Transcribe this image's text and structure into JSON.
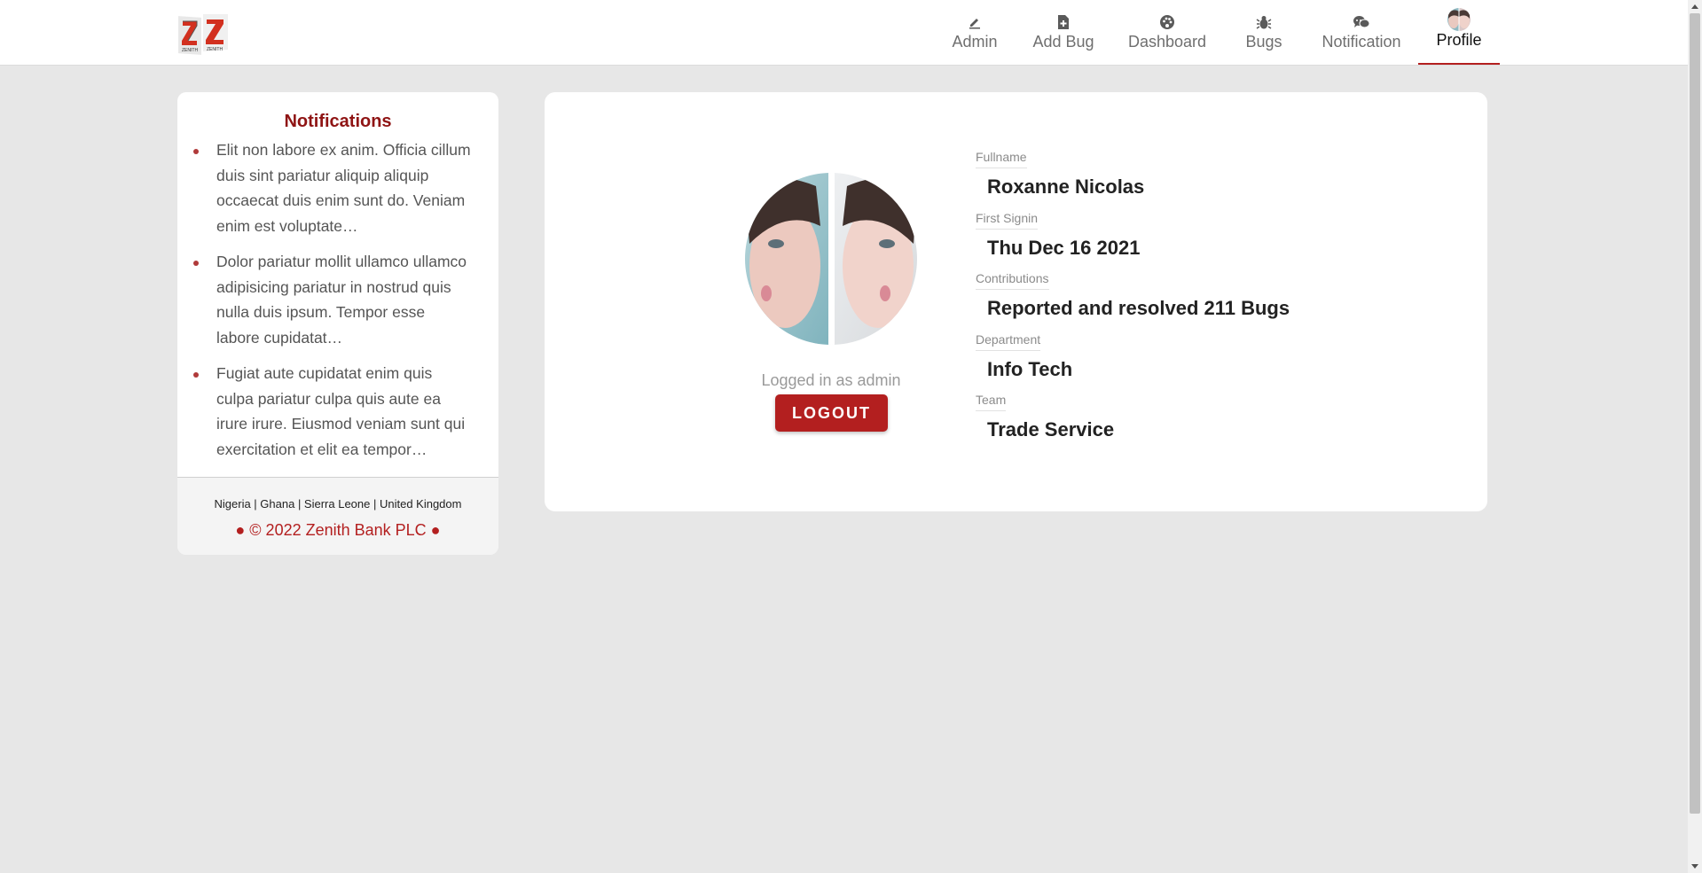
{
  "header": {
    "logo_icon": "zenith-bank-logo",
    "nav": [
      {
        "label": "Admin",
        "icon": "pencil-icon"
      },
      {
        "label": "Add Bug",
        "icon": "file-plus-icon"
      },
      {
        "label": "Dashboard",
        "icon": "palette-icon"
      },
      {
        "label": "Bugs",
        "icon": "bug-icon"
      },
      {
        "label": "Notification",
        "icon": "chat-bubbles-icon"
      },
      {
        "label": "Profile",
        "icon": "avatar",
        "active": true
      }
    ]
  },
  "notifications": {
    "title": "Notifications",
    "items": [
      "Elit non labore ex anim. Officia cillum duis sint pariatur aliquip aliquip occaecat duis enim sunt do. Veniam enim est voluptate…",
      "Dolor pariatur mollit ullamco ullamco adipisicing pariatur in nostrud quis nulla duis ipsum. Tempor esse labore cupidatat…",
      "Fugiat aute cupidatat enim quis culpa pariatur culpa quis aute ea irure irure. Eiusmod veniam sunt qui exercitation et elit ea tempor…"
    ],
    "footer": {
      "countries": "Nigeria | Ghana | Sierra Leone | United Kingdom",
      "copyright": "● © 2022 Zenith Bank PLC ●"
    }
  },
  "profile": {
    "logged_in_text": "Logged in as admin",
    "logout_label": "LOGOUT",
    "fields": [
      {
        "label": "Fullname",
        "value": "Roxanne Nicolas"
      },
      {
        "label": "First Signin",
        "value": "Thu Dec 16 2021"
      },
      {
        "label": "Contributions",
        "value": "Reported and resolved 211 Bugs"
      },
      {
        "label": "Department",
        "value": "Info Tech"
      },
      {
        "label": "Team",
        "value": "Trade Service"
      }
    ]
  },
  "colors": {
    "brand_red": "#b31f1f",
    "title_red": "#8f1414",
    "page_bg": "#e7e7e7"
  }
}
